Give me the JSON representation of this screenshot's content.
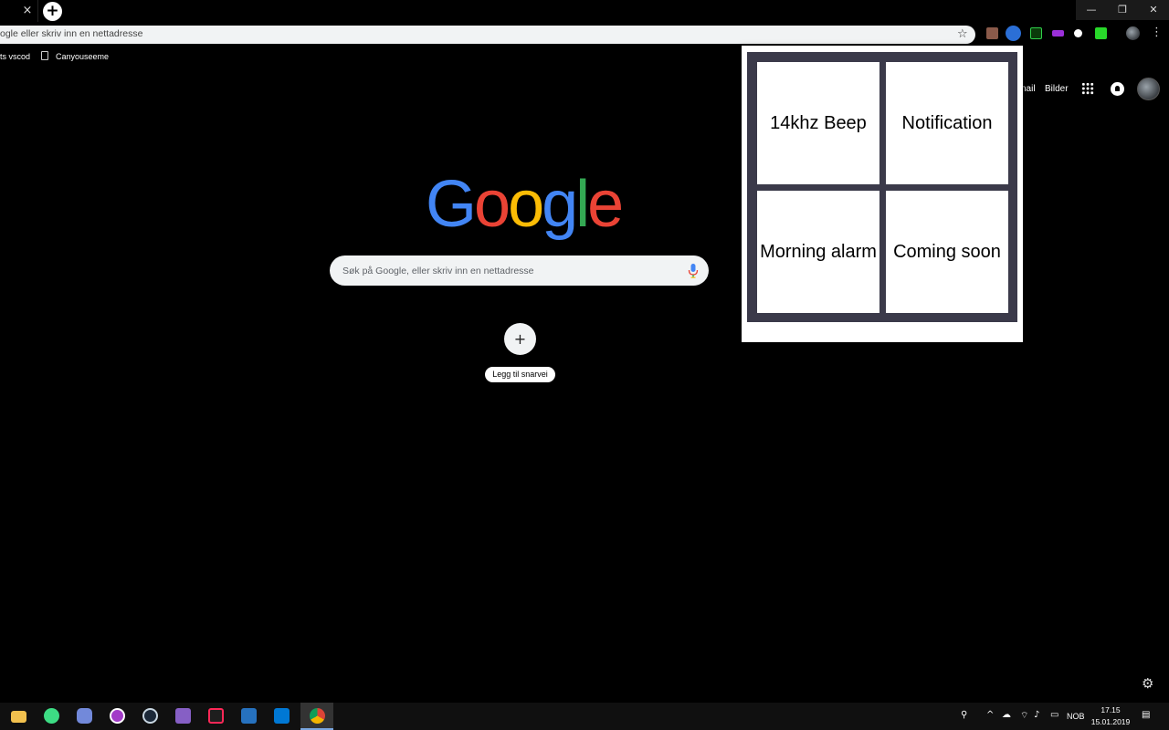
{
  "browser": {
    "tab_close_glyph": "×",
    "new_tab_glyph": "+",
    "window_controls": {
      "minimize": "—",
      "maximize": "❐",
      "close": "✕"
    },
    "omnibox_placeholder": "ogle eller skriv inn en nettadresse",
    "star_glyph": "☆",
    "menu_glyph": "⋮",
    "bookmarks": [
      {
        "label": "ts vscod"
      },
      {
        "label": "Canyouseeme"
      }
    ]
  },
  "google": {
    "header_links": {
      "gmail": "nail",
      "images": "Bilder"
    },
    "logo_letters": [
      {
        "ch": "G",
        "color": "#4285F4"
      },
      {
        "ch": "o",
        "color": "#EA4335"
      },
      {
        "ch": "o",
        "color": "#FBBC05"
      },
      {
        "ch": "g",
        "color": "#4285F4"
      },
      {
        "ch": "l",
        "color": "#34A853"
      },
      {
        "ch": "e",
        "color": "#EA4335"
      }
    ],
    "search_placeholder": "Søk på Google, eller skriv inn en nettadresse",
    "add_shortcut_glyph": "+",
    "add_shortcut_label": "Legg til snarvei",
    "settings_glyph": "⚙"
  },
  "popup": {
    "buttons": [
      {
        "label": "14khz Beep"
      },
      {
        "label": "Notification"
      },
      {
        "label": "Morning alarm"
      },
      {
        "label": "Coming soon"
      }
    ]
  },
  "taskbar": {
    "language": "NOB",
    "time": "17.15",
    "date": "15.01.2019"
  }
}
